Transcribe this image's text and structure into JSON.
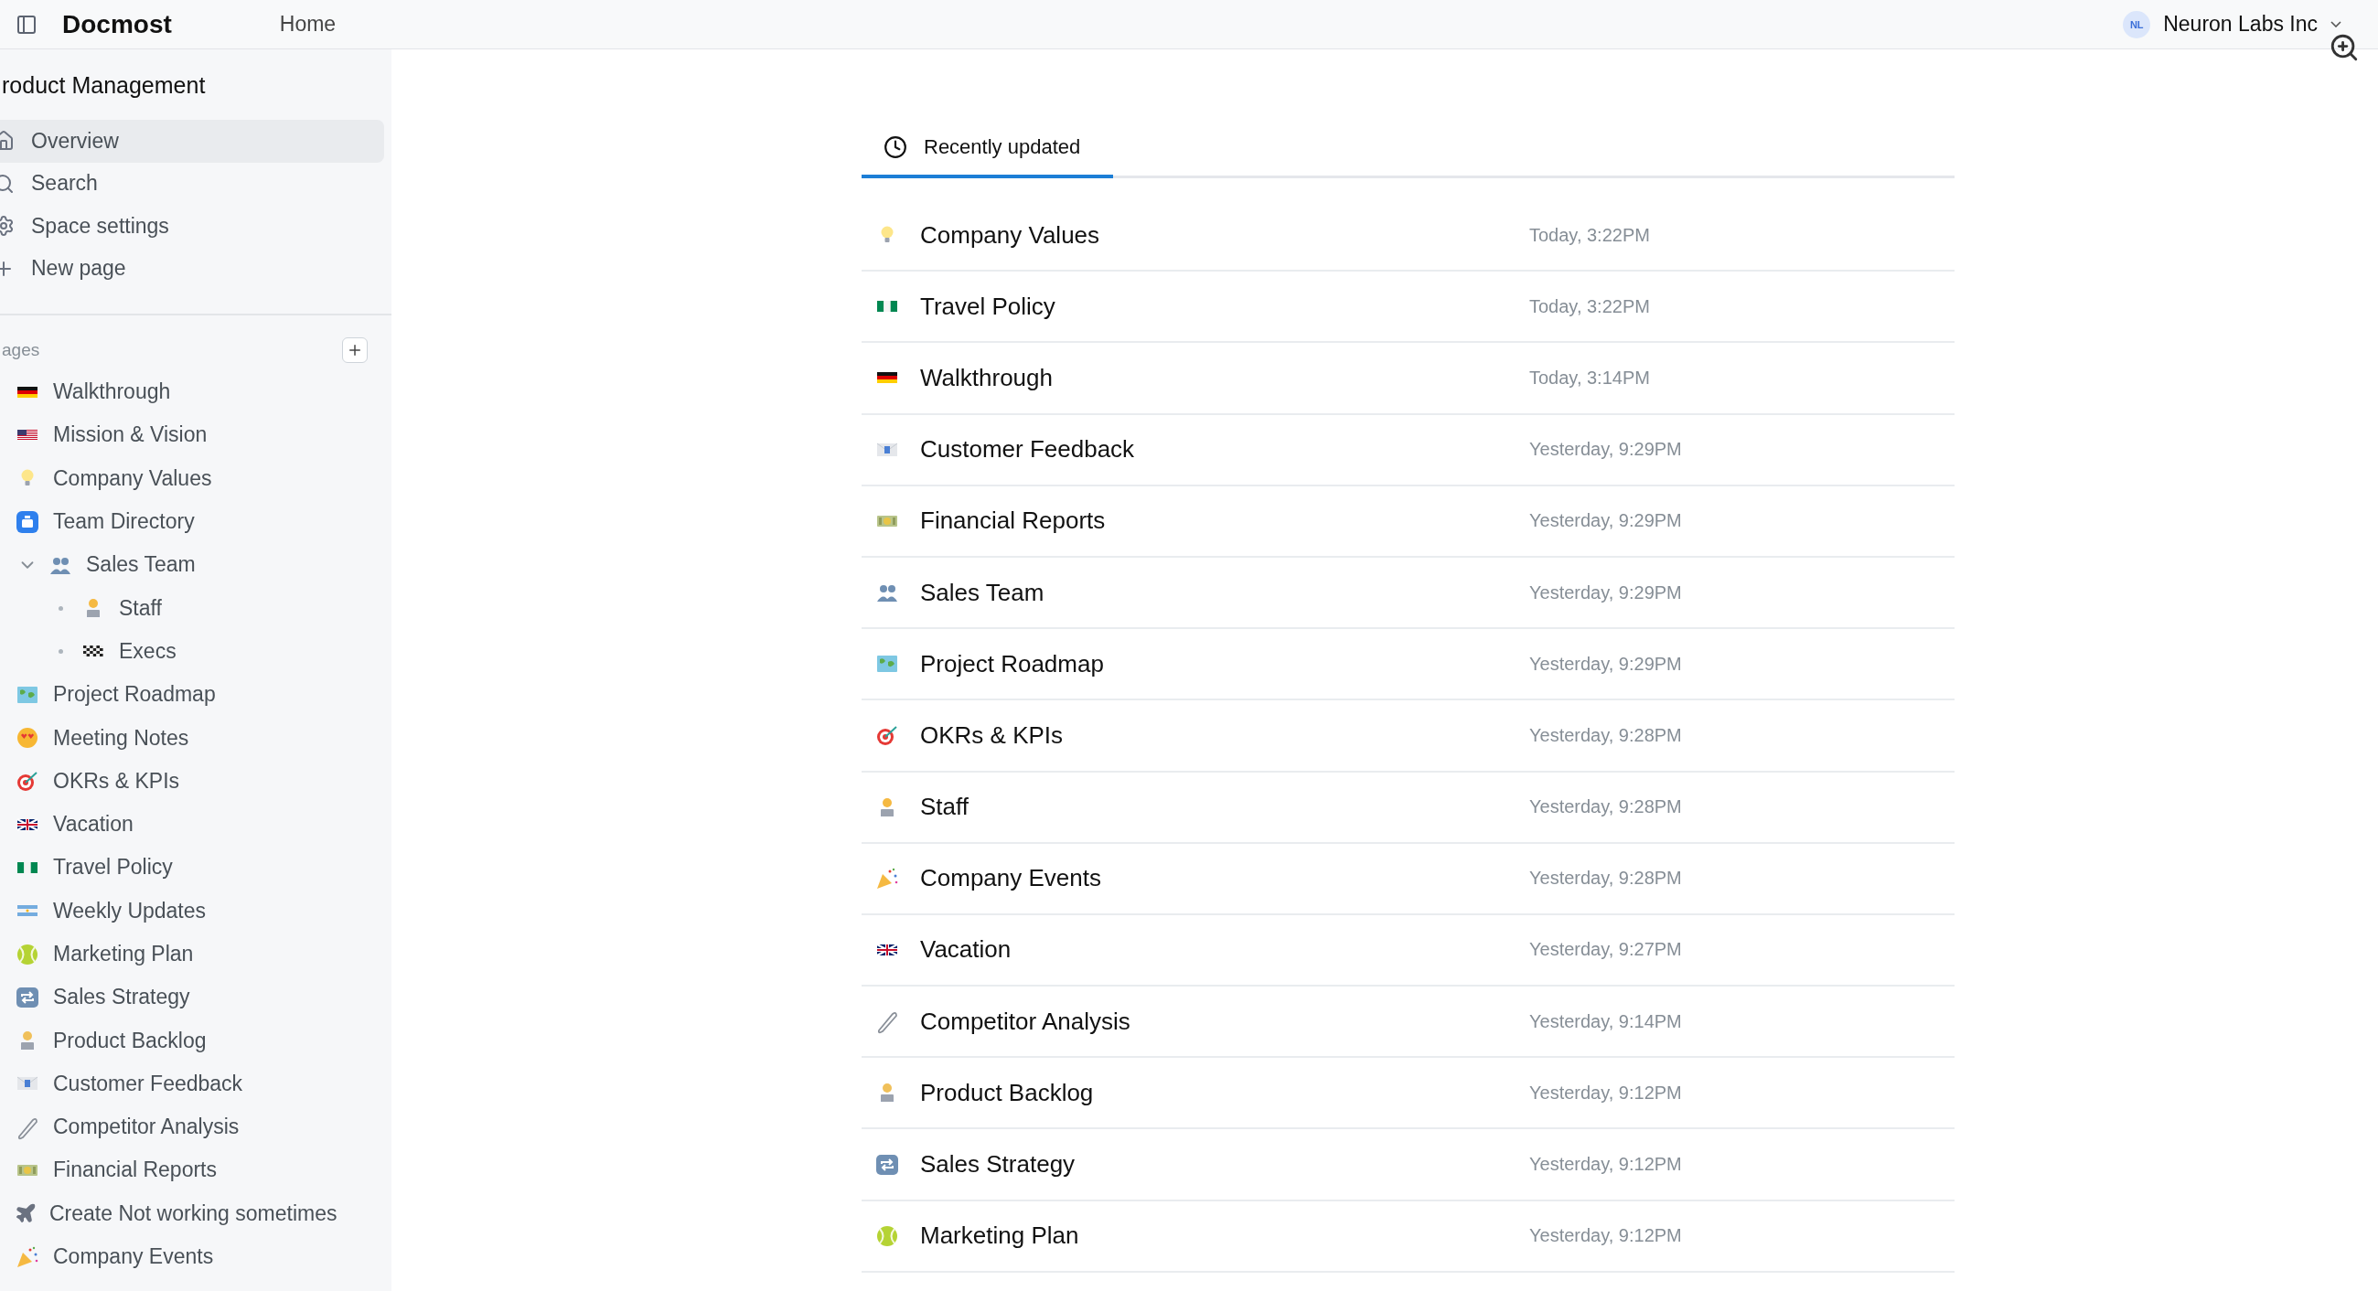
{
  "header": {
    "brand": "Docmost",
    "nav": "Home",
    "workspace": {
      "initials": "NL",
      "name": "Neuron Labs Inc"
    }
  },
  "sidebar": {
    "space_title": "roduct Management",
    "nav": [
      {
        "label": "Overview",
        "kind": "home",
        "selected": true
      },
      {
        "label": "Search",
        "kind": "search",
        "selected": false
      },
      {
        "label": "Space settings",
        "kind": "settings",
        "selected": false
      },
      {
        "label": "New page",
        "kind": "plus",
        "selected": false
      }
    ],
    "pages_heading": "ages",
    "pages": [
      {
        "label": "Walkthrough",
        "kind": "flagde"
      },
      {
        "label": "Mission & Vision",
        "kind": "flagus"
      },
      {
        "label": "Company Values",
        "kind": "bulb"
      },
      {
        "label": "Team Directory",
        "kind": "badge"
      },
      {
        "label": "Sales Team",
        "kind": "people",
        "expanded": true,
        "children": [
          {
            "label": "Staff",
            "kind": "worker"
          },
          {
            "label": "Execs",
            "kind": "checkered"
          }
        ]
      },
      {
        "label": "Project Roadmap",
        "kind": "map"
      },
      {
        "label": "Meeting Notes",
        "kind": "hearteyes"
      },
      {
        "label": "OKRs & KPIs",
        "kind": "target"
      },
      {
        "label": "Vacation",
        "kind": "flaguk"
      },
      {
        "label": "Travel Policy",
        "kind": "flagng"
      },
      {
        "label": "Weekly Updates",
        "kind": "flagar"
      },
      {
        "label": "Marketing Plan",
        "kind": "ball"
      },
      {
        "label": "Sales Strategy",
        "kind": "repeat"
      },
      {
        "label": "Product Backlog",
        "kind": "worker2"
      },
      {
        "label": "Customer Feedback",
        "kind": "envelope"
      },
      {
        "label": "Competitor Analysis",
        "kind": "pin"
      },
      {
        "label": "Financial Reports",
        "kind": "money"
      },
      {
        "label": "Create Not working sometimes",
        "kind": "airplane"
      },
      {
        "label": "Company Events",
        "kind": "party"
      }
    ]
  },
  "main": {
    "tabs": [
      {
        "label": "Recently updated",
        "selected": true
      }
    ],
    "recent": [
      {
        "title": "Company Values",
        "kind": "bulb",
        "updated": "Today, 3:22PM"
      },
      {
        "title": "Travel Policy",
        "kind": "flagng",
        "updated": "Today, 3:22PM"
      },
      {
        "title": "Walkthrough",
        "kind": "flagde",
        "updated": "Today, 3:14PM"
      },
      {
        "title": "Customer Feedback",
        "kind": "envelope",
        "updated": "Yesterday, 9:29PM"
      },
      {
        "title": "Financial Reports",
        "kind": "money",
        "updated": "Yesterday, 9:29PM"
      },
      {
        "title": "Sales Team",
        "kind": "people",
        "updated": "Yesterday, 9:29PM"
      },
      {
        "title": "Project Roadmap",
        "kind": "map",
        "updated": "Yesterday, 9:29PM"
      },
      {
        "title": "OKRs & KPIs",
        "kind": "target",
        "updated": "Yesterday, 9:28PM"
      },
      {
        "title": "Staff",
        "kind": "worker",
        "updated": "Yesterday, 9:28PM"
      },
      {
        "title": "Company Events",
        "kind": "party",
        "updated": "Yesterday, 9:28PM"
      },
      {
        "title": "Vacation",
        "kind": "flaguk",
        "updated": "Yesterday, 9:27PM"
      },
      {
        "title": "Competitor Analysis",
        "kind": "pin",
        "updated": "Yesterday, 9:14PM"
      },
      {
        "title": "Product Backlog",
        "kind": "worker2",
        "updated": "Yesterday, 9:12PM"
      },
      {
        "title": "Sales Strategy",
        "kind": "repeat",
        "updated": "Yesterday, 9:12PM"
      },
      {
        "title": "Marketing Plan",
        "kind": "ball",
        "updated": "Yesterday, 9:12PM"
      }
    ]
  }
}
